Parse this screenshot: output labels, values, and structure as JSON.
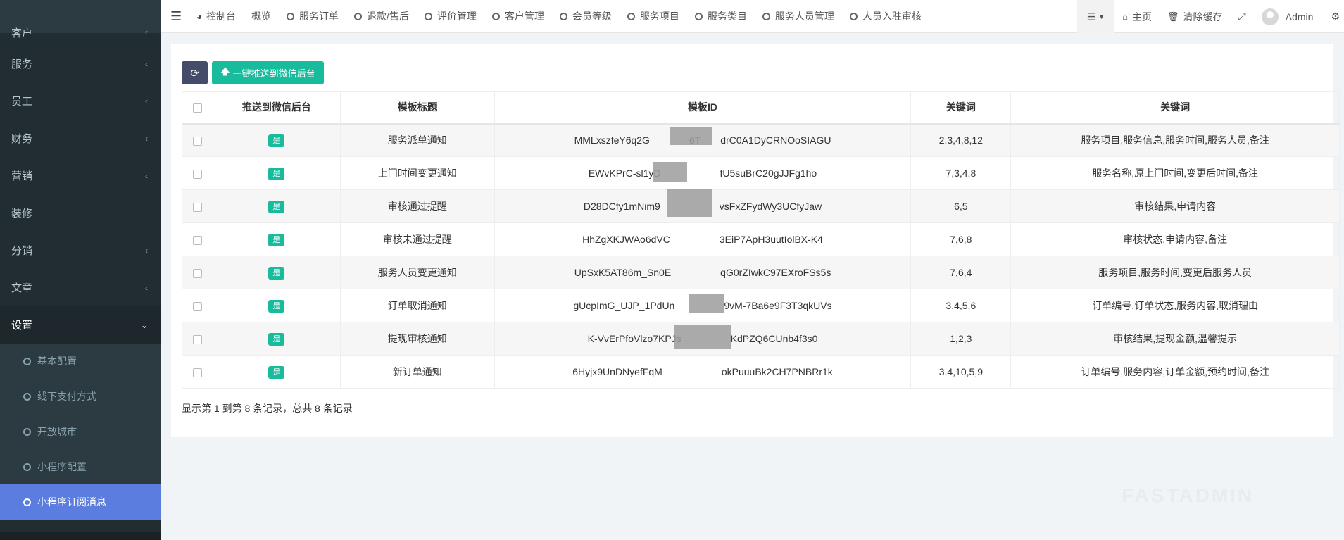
{
  "sidebar": {
    "items": [
      {
        "label": "客户"
      },
      {
        "label": "服务"
      },
      {
        "label": "员工"
      },
      {
        "label": "财务"
      },
      {
        "label": "营销"
      },
      {
        "label": "装修"
      },
      {
        "label": "分销"
      },
      {
        "label": "文章"
      },
      {
        "label": "设置"
      }
    ],
    "sub_items": [
      {
        "label": "基本配置"
      },
      {
        "label": "线下支付方式"
      },
      {
        "label": "开放城市"
      },
      {
        "label": "小程序配置"
      },
      {
        "label": "小程序订阅消息"
      }
    ]
  },
  "topbar": {
    "dashboard": "控制台",
    "overview": "概览",
    "links": [
      "服务订单",
      "退款/售后",
      "评价管理",
      "客户管理",
      "会员等级",
      "服务项目",
      "服务类目",
      "服务人员管理",
      "人员入驻审核"
    ],
    "home": "主页",
    "clear_cache": "清除缓存",
    "user": "Admin"
  },
  "toolbar": {
    "push_label": "一键推送到微信后台"
  },
  "table": {
    "headers": [
      "推送到微信后台",
      "模板标题",
      "模板ID",
      "关键词",
      "关键词"
    ],
    "rows": [
      {
        "pushed": "是",
        "title": "服务派单通知",
        "template_id": "MMLxszfeY6q2G    6T  drC0A1DyCRNOoSIAGU",
        "kw_ids": "2,3,4,8,12",
        "keywords": "服务项目,服务信息,服务时间,服务人员,备注"
      },
      {
        "pushed": "是",
        "title": "上门时间变更通知",
        "template_id": "EWvKPrC-sl1yD      fU5suBrC20gJJFg1ho",
        "kw_ids": "7,3,4,8",
        "keywords": "服务名称,原上门时间,变更后时间,备注"
      },
      {
        "pushed": "是",
        "title": "审核通过提醒",
        "template_id": "D28DCfy1mNim9      vsFxZFydWy3UCfyJaw",
        "kw_ids": "6,5",
        "keywords": "审核结果,申请内容"
      },
      {
        "pushed": "是",
        "title": "审核未通过提醒",
        "template_id": "HhZgXKJWAo6dVC     3EiP7ApH3uutIolBX-K4",
        "kw_ids": "7,6,8",
        "keywords": "审核状态,申请内容,备注"
      },
      {
        "pushed": "是",
        "title": "服务人员变更通知",
        "template_id": "UpSxK5AT86m_Sn0E     qG0rZIwkC97EXroFSs5s",
        "kw_ids": "7,6,4",
        "keywords": "服务项目,服务时间,变更后服务人员"
      },
      {
        "pushed": "是",
        "title": "订单取消通知",
        "template_id": "gUcpImG_UJP_1PdUn     9vM-7Ba6e9F3T3qkUVs",
        "kw_ids": "3,4,5,6",
        "keywords": "订单编号,订单状态,服务内容,取消理由"
      },
      {
        "pushed": "是",
        "title": "提现审核通知",
        "template_id": "K-VvErPfoVlzo7KPJs     KdPZQ6CUnb4f3s0",
        "kw_ids": "1,2,3",
        "keywords": "审核结果,提现金额,温馨提示"
      },
      {
        "pushed": "是",
        "title": "新订单通知",
        "template_id": "6Hyjx9UnDNyefFqM      okPuuuBk2CH7PNBRr1k",
        "kw_ids": "3,4,10,5,9",
        "keywords": "订单编号,服务内容,订单金额,预约时间,备注"
      }
    ]
  },
  "pagination": {
    "summary": "显示第 1 到第 8 条记录，总共 8 条记录"
  },
  "watermark": "FASTADMIN",
  "colors": {
    "sidebar_bg": "#222d32",
    "active_menu": "#5b7ddf",
    "accent": "#18bc9c",
    "refresh_btn": "#444c69"
  }
}
